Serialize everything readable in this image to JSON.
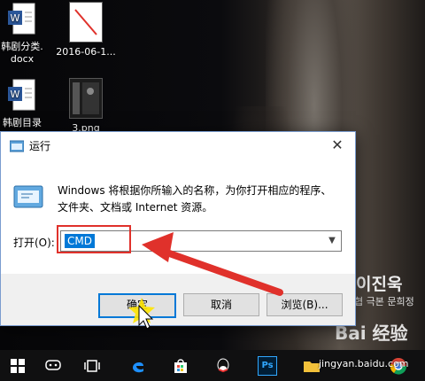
{
  "desktop": {
    "icons": [
      {
        "label": "韩剧分类.\ndocx"
      },
      {
        "label": "2016-06-1..."
      },
      {
        "label": "韩剧目录"
      },
      {
        "label": "3.png"
      }
    ],
    "poster_name": "이진욱",
    "poster_sub": "협 극본 문희정",
    "baidu_logo": "Bai 经验"
  },
  "dialog": {
    "title": "运行",
    "description": "Windows 将根据你所输入的名称，为你打开相应的程序、文件夹、文档或 Internet 资源。",
    "open_label": "打开(O):",
    "input_value": "CMD",
    "ok_label": "确定",
    "cancel_label": "取消",
    "browse_label": "浏览(B)..."
  },
  "watermark": "jingyan.baidu.com",
  "colors": {
    "accent": "#0078d7",
    "annotation": "#e0312b"
  },
  "taskbar": {
    "icons": [
      "windows-start-icon",
      "cortana-icon",
      "task-view-icon",
      "edge-icon",
      "store-icon",
      "qq-icon",
      "photoshop-icon",
      "file-explorer-icon",
      "chrome-icon"
    ],
    "photoshop_text": "Ps"
  }
}
